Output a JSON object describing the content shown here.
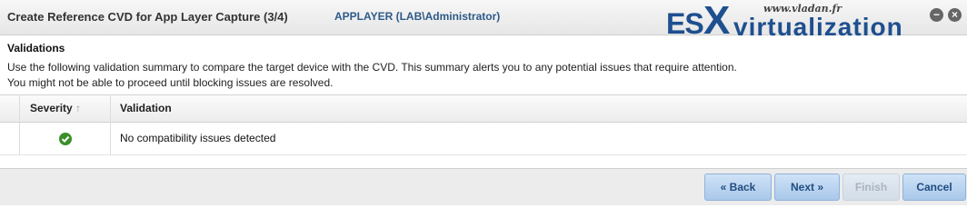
{
  "window": {
    "title": "Create Reference CVD for App Layer Capture (3/4)",
    "context": "APPLAYER (LAB\\Administrator)"
  },
  "watermark": {
    "url": "www.vladan.fr",
    "brand_es": "ES",
    "brand_x": "X",
    "brand_virtualization": "virtualization"
  },
  "section": {
    "title": "Validations",
    "description_line1": "Use the following validation summary to compare the target device with the CVD. This summary alerts you to any potential issues that require attention.",
    "description_line2": "You might not be able to proceed until blocking issues are resolved."
  },
  "table": {
    "columns": [
      "Severity",
      "Validation"
    ],
    "rows": [
      {
        "severity_icon": "success-check-icon",
        "validation": "No compatibility issues detected"
      }
    ]
  },
  "buttons": {
    "back": "« Back",
    "next": "Next »",
    "finish": "Finish",
    "cancel": "Cancel"
  },
  "colors": {
    "accent": "#2d5a88",
    "success": "#3a8f2a",
    "button_bg": "#bcd6f1"
  }
}
